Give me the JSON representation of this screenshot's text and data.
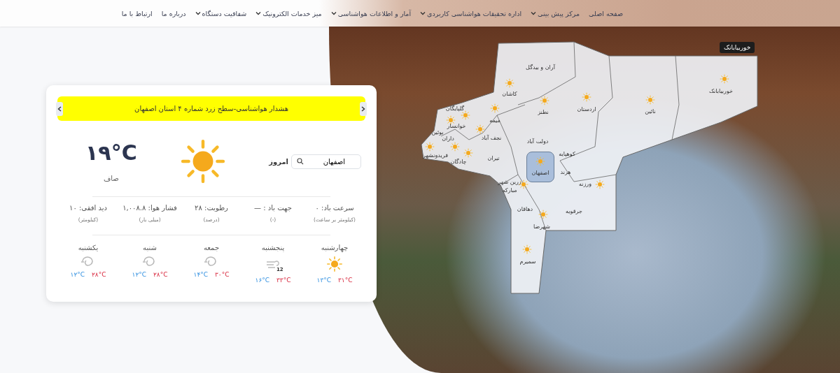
{
  "nav": {
    "items": [
      {
        "label": "صفحه اصلی",
        "has_menu": false
      },
      {
        "label": "مرکز پیش بینی",
        "has_menu": true
      },
      {
        "label": "اداره تحقیقات هواشناسی کاربردی",
        "has_menu": true
      },
      {
        "label": "آمار و اطلاعات هواشناسی",
        "has_menu": true
      },
      {
        "label": "میز خدمات الکترونیک",
        "has_menu": true
      },
      {
        "label": "شفافیت دستگاه",
        "has_menu": true
      },
      {
        "label": "درباره ما",
        "has_menu": false
      },
      {
        "label": "ارتباط با ما",
        "has_menu": false
      }
    ]
  },
  "weather_card": {
    "alert": "هشدار هواشناسی-سطح زرد شماره ۴ استان اصفهان",
    "search": {
      "value": "اصفهان"
    },
    "day_label": "امروز",
    "temperature": "۱۹°C",
    "condition": "صاف",
    "stats": [
      {
        "label": "سرعت باد: ۰",
        "unit": "(کیلومتر بر ساعت)"
      },
      {
        "label": "جهت باد : —",
        "unit": "(-)"
      },
      {
        "label": "رطوبت: ۲۸",
        "unit": "(درصد)"
      },
      {
        "label": "فشار هوا: ۱,۰۰۸.۸",
        "unit": "(میلی بار)"
      },
      {
        "label": "دید افقی: ۱۰",
        "unit": "(کیلومتر)"
      }
    ],
    "forecast": [
      {
        "day": "چهارشنبه",
        "kind": "sunny",
        "max": "۳۱°C",
        "min": "۱۳°C"
      },
      {
        "day": "پنجشنبه",
        "kind": "windy",
        "badge": "12",
        "max": "۳۳°C",
        "min": "۱۶°C"
      },
      {
        "day": "جمعه",
        "kind": "dust",
        "max": "۳۰°C",
        "min": "۱۴°C"
      },
      {
        "day": "شنبه",
        "kind": "dust",
        "max": "۲۸°C",
        "min": "۱۲°C"
      },
      {
        "day": "یکشنبه",
        "kind": "dust",
        "max": "۲۸°C",
        "min": "۱۲°C"
      }
    ]
  },
  "map": {
    "tooltip": "خوربیابانک",
    "counties": [
      {
        "name": "آران و بیدگل",
        "sunny": false,
        "selected": false
      },
      {
        "name": "خوربیابانک",
        "sunny": true,
        "selected": false
      },
      {
        "name": "کاشان",
        "sunny": true,
        "selected": false
      },
      {
        "name": "نائین",
        "sunny": true,
        "selected": false
      },
      {
        "name": "اردستان",
        "sunny": true,
        "selected": false
      },
      {
        "name": "نطنز",
        "sunny": true,
        "selected": false
      },
      {
        "name": "گلپایگان",
        "sunny": true,
        "selected": false
      },
      {
        "name": "میمه",
        "sunny": true,
        "selected": false
      },
      {
        "name": "خوانسار",
        "sunny": true,
        "selected": false
      },
      {
        "name": "دولت آباد",
        "sunny": false,
        "selected": false
      },
      {
        "name": "نجف آباد",
        "sunny": true,
        "selected": false
      },
      {
        "name": "داران",
        "sunny": true,
        "selected": false
      },
      {
        "name": "بوئین",
        "sunny": false,
        "selected": false
      },
      {
        "name": "کوهپایه",
        "sunny": false,
        "selected": false
      },
      {
        "name": "تیران",
        "sunny": false,
        "selected": false
      },
      {
        "name": "چادگان",
        "sunny": true,
        "selected": false
      },
      {
        "name": "فریدونشهر",
        "sunny": true,
        "selected": false
      },
      {
        "name": "هرند",
        "sunny": false,
        "selected": false
      },
      {
        "name": "اصفهان",
        "sunny": true,
        "selected": true
      },
      {
        "name": "ورزنه",
        "sunny": true,
        "selected": false
      },
      {
        "name": "زرین شهر",
        "sunny": false,
        "selected": false
      },
      {
        "name": "مبارکه",
        "sunny": true,
        "selected": false
      },
      {
        "name": "جرقویه",
        "sunny": false,
        "selected": false
      },
      {
        "name": "دهاقان",
        "sunny": false,
        "selected": false
      },
      {
        "name": "شهرضا",
        "sunny": true,
        "selected": false
      },
      {
        "name": "سمیرم",
        "sunny": true,
        "selected": false
      }
    ]
  }
}
